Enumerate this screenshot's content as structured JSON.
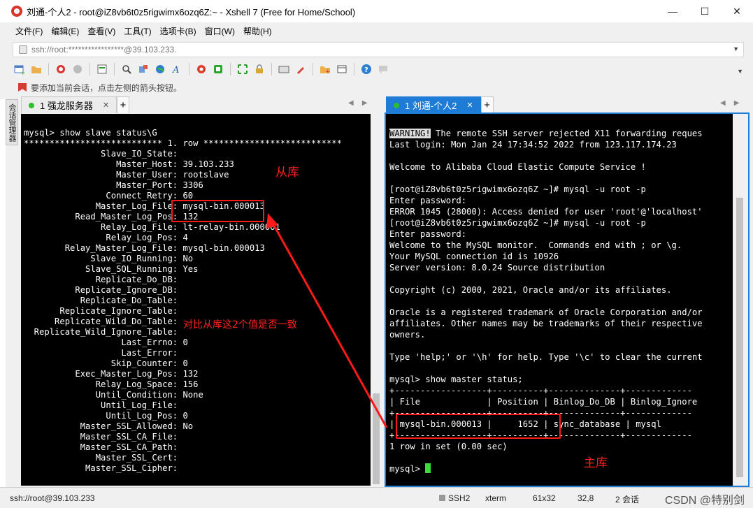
{
  "window": {
    "title": "刘通-个人2 - root@iZ8vb6t0z5rigwimx6ozq6Z:~ - Xshell 7 (Free for Home/School)",
    "minimize": "—",
    "maximize": "☐",
    "close": "✕"
  },
  "menu": [
    "文件(F)",
    "编辑(E)",
    "查看(V)",
    "工具(T)",
    "选项卡(B)",
    "窗口(W)",
    "帮助(H)"
  ],
  "address": {
    "value": "ssh://root:*****************@39.103.233."
  },
  "toolbar_icons": [
    "new-session-icon",
    "open-folder-icon",
    "disconnect-icon",
    "reconnect-icon",
    "properties-icon",
    "find-icon",
    "transfer-icon",
    "globe-icon",
    "font-icon",
    "xftp-icon",
    "xmanager-icon",
    "fullscreen-icon",
    "lock-icon",
    "keyboard-icon",
    "highlight-icon",
    "new-tab-icon",
    "layout-icon",
    "help-icon",
    "chat-icon"
  ],
  "hint": "要添加当前会话，点击左侧的箭头按钮。",
  "side_tab": "会话管理器",
  "tabs_left": [
    {
      "label": "1 强龙服务器",
      "close": "✕"
    }
  ],
  "tabs_right": [
    {
      "label": "1 刘通-个人2",
      "close": "✕"
    }
  ],
  "tab_add": "+",
  "tab_nav": [
    "◀",
    "▶"
  ],
  "term_left": {
    "lines": [
      "mysql> show slave status\\G",
      "*************************** 1. row ***************************",
      "               Slave_IO_State: ",
      "                  Master_Host: 39.103.233",
      "                  Master_User: rootslave",
      "                  Master_Port: 3306",
      "                Connect_Retry: 60",
      "              Master_Log_File: mysql-bin.000013",
      "          Read_Master_Log_Pos: 132",
      "               Relay_Log_File: lt-relay-bin.000001",
      "                Relay_Log_Pos: 4",
      "        Relay_Master_Log_File: mysql-bin.000013",
      "             Slave_IO_Running: No",
      "            Slave_SQL_Running: Yes",
      "              Replicate_Do_DB: ",
      "          Replicate_Ignore_DB: ",
      "           Replicate_Do_Table: ",
      "       Replicate_Ignore_Table: ",
      "      Replicate_Wild_Do_Table: ",
      "  Replicate_Wild_Ignore_Table: ",
      "                   Last_Errno: 0",
      "                   Last_Error: ",
      "                 Skip_Counter: 0",
      "          Exec_Master_Log_Pos: 132",
      "              Relay_Log_Space: 156",
      "              Until_Condition: None",
      "               Until_Log_File: ",
      "                Until_Log_Pos: 0",
      "           Master_SSL_Allowed: No",
      "           Master_SSL_CA_File: ",
      "           Master_SSL_CA_Path: ",
      "              Master_SSL_Cert: ",
      "            Master_SSL_Cipher: "
    ]
  },
  "term_right": {
    "warning_tag": "WARNING!",
    "warning_rest": " The remote SSH server rejected X11 forwarding reques",
    "lines": [
      "Last login: Mon Jan 24 17:34:52 2022 from 123.117.174.23",
      "",
      "Welcome to Alibaba Cloud Elastic Compute Service !",
      "",
      "[root@iZ8vb6t0z5rigwimx6ozq6Z ~]# mysql -u root -p",
      "Enter password: ",
      "ERROR 1045 (28000): Access denied for user 'root'@'localhost'",
      "[root@iZ8vb6t0z5rigwimx6ozq6Z ~]# mysql -u root -p",
      "Enter password: ",
      "Welcome to the MySQL monitor.  Commands end with ; or \\g.",
      "Your MySQL connection id is 10926",
      "Server version: 8.0.24 Source distribution",
      "",
      "Copyright (c) 2000, 2021, Oracle and/or its affiliates.",
      "",
      "Oracle is a registered trademark of Oracle Corporation and/or",
      "affiliates. Other names may be trademarks of their respective",
      "owners.",
      "",
      "Type 'help;' or '\\h' for help. Type '\\c' to clear the current",
      "",
      "mysql> show master status;",
      "+------------------+----------+--------------+-------------",
      "| File             | Position | Binlog_Do_DB | Binlog_Ignore",
      "+------------------+----------+--------------+-------------",
      "| mysql-bin.000013 |     1652 | sync_database | mysql",
      "+------------------+----------+--------------+-------------",
      "1 row in set (0.00 sec)",
      ""
    ],
    "prompt": "mysql> "
  },
  "annotations": {
    "slave": "从库",
    "compare": "对比从库这2个值是否一致",
    "master": "主库",
    "color": "#ff1a1a"
  },
  "status": {
    "session": "ssh://root@39.103.233",
    "protocol": "SSH2",
    "term": "xterm",
    "size": "61x32",
    "pos": "32,8",
    "sessions": "2 会话",
    "watermark": "CSDN @特别剑"
  }
}
